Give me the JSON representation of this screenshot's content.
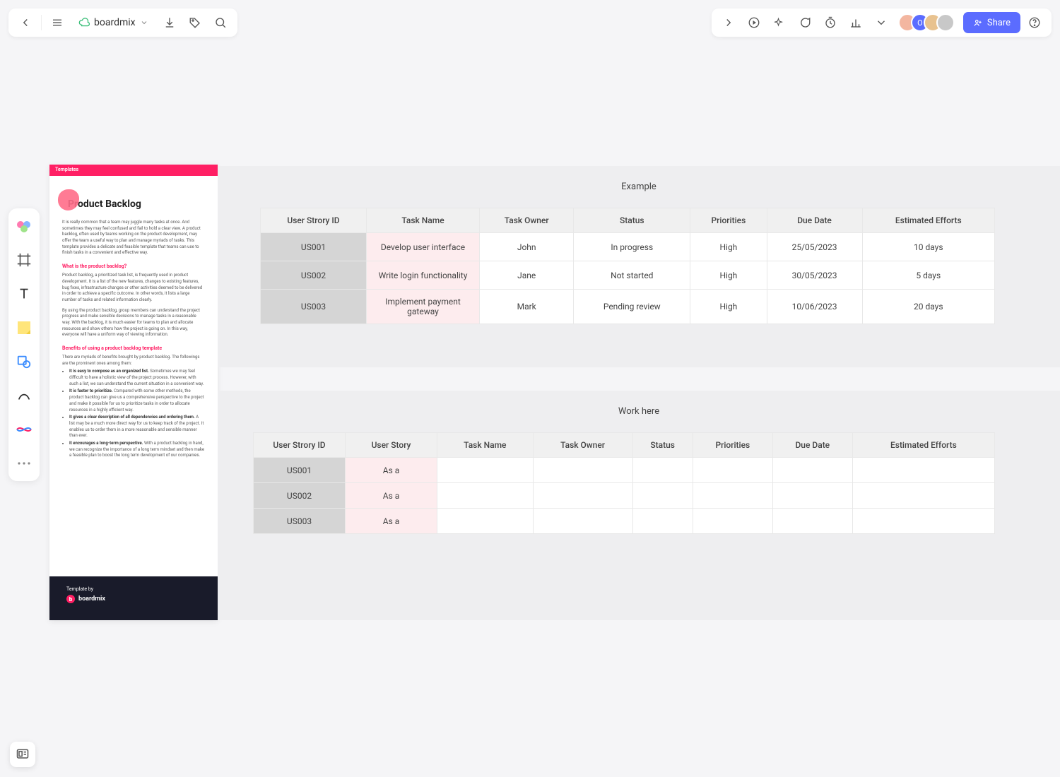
{
  "header": {
    "brand": "boardmix",
    "share": "Share"
  },
  "avatars": {
    "badge": "O"
  },
  "info_card": {
    "templates_label": "Templates",
    "title": "Product Backlog",
    "intro": "It is really common that a team may juggle many tasks at once. And sometimes they may feel confused and fail to hold a clear view. A product backlog, often used by teams working on the product development, may offer the team a useful way to plan and manage myriads of tasks. This template provides a delicate and feasible template that teams can use to finish tasks in a convenient and effective way.",
    "sub1": "What is the product backlog?",
    "p2": "Product backlog, a prioritized task list, is frequently used in product development. It is a list of the new features, changes to existing features, bug fixes, infrastructure changes or other activities deemed to be delivered in order to achieve a specific outcome. In other words, it lists a large number of tasks and related information clearly.",
    "p3": "By using the product backlog, group members can understand the project progress and make sensible decisions to manage tasks in a reasonable way. With the backlog, it is much easier for teams to plan and allocate resources and show others how the project is going on. In this way, everyone will have a uniform way of viewing information.",
    "sub2": "Benefits of using a product backlog template",
    "p4": "There are myriads of benefits brought by product backlog. The followings are the prominent ones among them:",
    "b1": "It is easy to compose as an organized list.",
    "b1t": " Sometimes we may feel difficult to have a holistic view of the project process. However, with such a list, we can understand the current situation in a convenient way.",
    "b2": "It is faster to prioritize.",
    "b2t": " Compared with some other methods, the product backlog can give us a comprehensive perspective to the project and make it possible for us to prioritize tasks in order to allocate resources in a highly efficient way.",
    "b3": "It gives a clear description of all dependencies and ordering them.",
    "b3t": " A list may be a much more direct way for us to keep track of the project. It enables us to order them in a more reasonable and sensible manner than ever.",
    "b4": "It encourages a long-term perspective.",
    "b4t": " With a product backlog in hand, we can recognize the importance of a long term mindset and then make a feasible plan to boost the long term development of our companies.",
    "footer_label": "Template by",
    "footer_brand": "boardmix"
  },
  "example": {
    "title": "Example",
    "headers": [
      "User Strory ID",
      "Task Name",
      "Task Owner",
      "Status",
      "Priorities",
      "Due Date",
      "Estimated Efforts"
    ],
    "rows": [
      {
        "id": "US001",
        "task": "Develop user interface",
        "owner": "John",
        "status": "In progress",
        "prio": "High",
        "due": "25/05/2023",
        "eff": "10 days"
      },
      {
        "id": "US002",
        "task": "Write login functionality",
        "owner": "Jane",
        "status": "Not started",
        "prio": "High",
        "due": "30/05/2023",
        "eff": "5 days"
      },
      {
        "id": "US003",
        "task": "Implement payment gateway",
        "owner": "Mark",
        "status": "Pending review",
        "prio": "High",
        "due": "10/06/2023",
        "eff": "20 days"
      }
    ]
  },
  "work": {
    "title": "Work here",
    "headers": [
      "User Strory ID",
      "User Story",
      "Task Name",
      "Task Owner",
      "Status",
      "Priorities",
      "Due Date",
      "Estimated Efforts"
    ],
    "rows": [
      {
        "id": "US001",
        "us": "As a"
      },
      {
        "id": "US002",
        "us": "As a"
      },
      {
        "id": "US003",
        "us": "As a"
      }
    ]
  }
}
